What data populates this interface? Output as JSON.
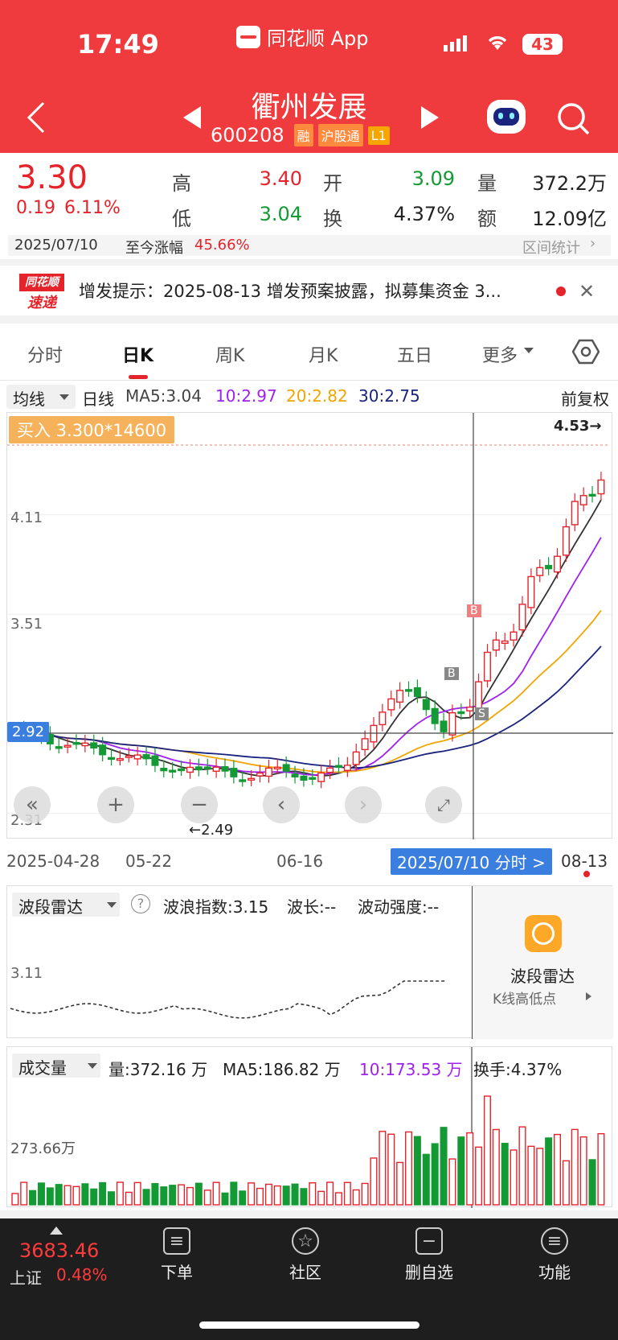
{
  "status": {
    "time": "17:49",
    "battery": "43"
  },
  "app": {
    "name": "同花顺 App"
  },
  "stock": {
    "name": "衢州发展",
    "code": "600208",
    "tags": [
      "融",
      "沪股通",
      "L1"
    ]
  },
  "quote": {
    "price": "3.30",
    "change": "0.19",
    "change_pct": "6.11%",
    "high_label": "高",
    "high": "3.40",
    "open_label": "开",
    "open": "3.09",
    "vol_label": "量",
    "vol": "372.2万",
    "low_label": "低",
    "low": "3.04",
    "turn_label": "换",
    "turn": "4.37%",
    "amt_label": "额",
    "amt": "12.09亿"
  },
  "range_row": {
    "date": "2025/07/10",
    "label": "至今涨幅",
    "value": "45.66%",
    "link": "区间统计"
  },
  "notice": {
    "logo_top": "同花顺",
    "logo_bottom": "速递",
    "text": "增发提示：2025-08-13 增发预案披露，拟募集资金 3..."
  },
  "tabs": [
    "分时",
    "日K",
    "周K",
    "月K",
    "五日",
    "更多"
  ],
  "ma_row": {
    "selector": "均线",
    "period": "日线",
    "ma5": "MA5:3.04",
    "ma10": "10:2.97",
    "ma20": "20:2.82",
    "ma30": "30:2.75",
    "adjust": "前复权"
  },
  "kline": {
    "buy_badge": "买入 3.300*14600",
    "max_marker": "4.53→",
    "min_marker": "←2.49",
    "y_labels": [
      "4.11",
      "3.51",
      "2.31"
    ],
    "crosshair_price": "2.92",
    "x_labels": [
      "2025-04-28",
      "05-22",
      "06-16",
      "08-13"
    ],
    "crosshair_date": "2025/07/10 分时 >",
    "b1": "B",
    "b2": "B",
    "s": "S"
  },
  "radar": {
    "selector": "波段雷达",
    "help": "?",
    "wave_index": "波浪指数:3.15",
    "wave_len": "波长:--",
    "wave_strength": "波动强度:--",
    "y_label": "3.11",
    "side_title": "波段雷达",
    "side_sub": "K线高低点"
  },
  "volume": {
    "selector": "成交量",
    "vol": "量:372.16 万",
    "ma5": "MA5:186.82 万",
    "ma10": "10:173.53 万",
    "turnover": "换手:4.37%",
    "y_label": "273.66万"
  },
  "bottom": {
    "index_value": "3683.46",
    "index_name": "上证",
    "index_pct": "0.48%",
    "items": [
      "下单",
      "社区",
      "删自选",
      "功能"
    ]
  },
  "colors": {
    "header_red": "#ef3b3d",
    "up": "#e5232b",
    "down": "#149a34",
    "ma5": "#333333",
    "ma10": "#a020f0",
    "ma20": "#f0a500",
    "ma30": "#1a237e"
  }
}
